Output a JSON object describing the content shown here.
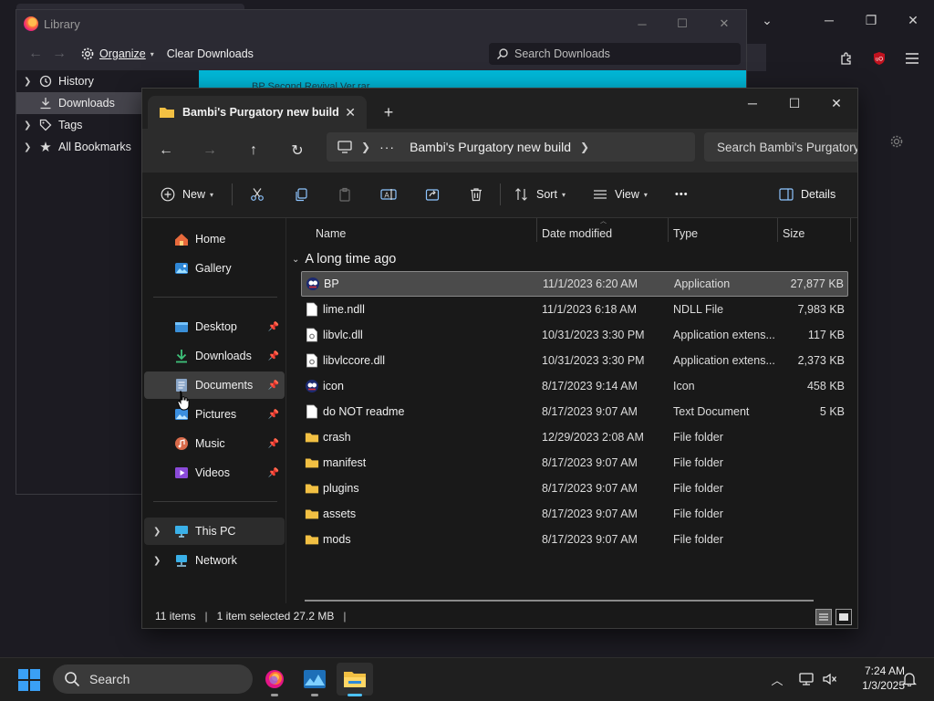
{
  "library": {
    "title": "Library",
    "organize": "Organize",
    "clear_downloads": "Clear Downloads",
    "search_placeholder": "Search Downloads",
    "sidebar": [
      {
        "label": "History",
        "icon": "history-icon",
        "expander": true,
        "selected": false
      },
      {
        "label": "Downloads",
        "icon": "download-icon",
        "expander": false,
        "selected": true
      },
      {
        "label": "Tags",
        "icon": "tag-icon",
        "expander": true,
        "selected": false
      },
      {
        "label": "All Bookmarks",
        "icon": "star-icon",
        "expander": true,
        "selected": false
      }
    ],
    "download_item": "BP Second Revival Ver.rar"
  },
  "explorer": {
    "tab_title": "Bambi's Purgatory new build",
    "breadcrumb": [
      "Bambi's Purgatory new build"
    ],
    "search_placeholder": "Search Bambi's Purgatory",
    "commands": {
      "new": "New",
      "sort": "Sort",
      "view": "View",
      "more": "•••",
      "details": "Details"
    },
    "nav": {
      "top": [
        {
          "label": "Home",
          "icon": "home-icon"
        },
        {
          "label": "Gallery",
          "icon": "gallery-icon"
        }
      ],
      "pinned": [
        {
          "label": "Desktop",
          "icon": "desktop-icon"
        },
        {
          "label": "Downloads",
          "icon": "download-icon"
        },
        {
          "label": "Documents",
          "icon": "documents-icon",
          "selected": true
        },
        {
          "label": "Pictures",
          "icon": "pictures-icon"
        },
        {
          "label": "Music",
          "icon": "music-icon"
        },
        {
          "label": "Videos",
          "icon": "videos-icon"
        }
      ],
      "bottom": [
        {
          "label": "This PC",
          "icon": "pc-icon",
          "selected": true
        },
        {
          "label": "Network",
          "icon": "network-icon"
        }
      ]
    },
    "columns": {
      "name": "Name",
      "date": "Date modified",
      "type": "Type",
      "size": "Size"
    },
    "group": "A long time ago",
    "files": [
      {
        "name": "BP",
        "date": "11/1/2023 6:20 AM",
        "type": "Application",
        "size": "27,877 KB",
        "kind": "app",
        "selected": true
      },
      {
        "name": "lime.ndll",
        "date": "11/1/2023 6:18 AM",
        "type": "NDLL File",
        "size": "7,983 KB",
        "kind": "file"
      },
      {
        "name": "libvlc.dll",
        "date": "10/31/2023 3:30 PM",
        "type": "Application extens...",
        "size": "117 KB",
        "kind": "dll"
      },
      {
        "name": "libvlccore.dll",
        "date": "10/31/2023 3:30 PM",
        "type": "Application extens...",
        "size": "2,373 KB",
        "kind": "dll"
      },
      {
        "name": "icon",
        "date": "8/17/2023 9:14 AM",
        "type": "Icon",
        "size": "458 KB",
        "kind": "app"
      },
      {
        "name": "do NOT readme",
        "date": "8/17/2023 9:07 AM",
        "type": "Text Document",
        "size": "5 KB",
        "kind": "file"
      },
      {
        "name": "crash",
        "date": "12/29/2023 2:08 AM",
        "type": "File folder",
        "size": "",
        "kind": "folder"
      },
      {
        "name": "manifest",
        "date": "8/17/2023 9:07 AM",
        "type": "File folder",
        "size": "",
        "kind": "folder"
      },
      {
        "name": "plugins",
        "date": "8/17/2023 9:07 AM",
        "type": "File folder",
        "size": "",
        "kind": "folder"
      },
      {
        "name": "assets",
        "date": "8/17/2023 9:07 AM",
        "type": "File folder",
        "size": "",
        "kind": "folder"
      },
      {
        "name": "mods",
        "date": "8/17/2023 9:07 AM",
        "type": "File folder",
        "size": "",
        "kind": "folder"
      }
    ],
    "status": {
      "count": "11 items",
      "selection": "1 item selected  27.2 MB"
    }
  },
  "taskbar": {
    "search_placeholder": "Search",
    "time": "7:24 AM",
    "date": "1/3/2025"
  },
  "colors": {
    "accent_blue": "#3aa0f5",
    "folder_yellow": "#f2c043",
    "download_cyan": "#00b6d6",
    "ublock_red": "#c1121f"
  }
}
